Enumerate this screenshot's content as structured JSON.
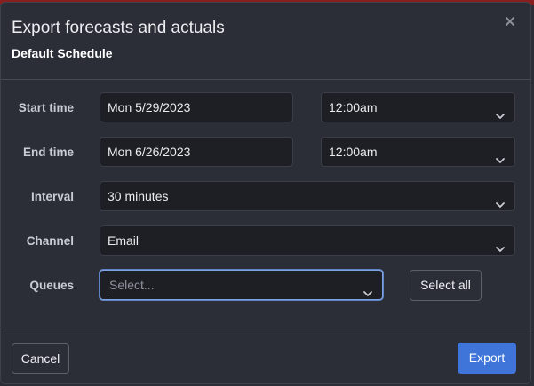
{
  "dialog": {
    "title": "Export forecasts and actuals",
    "subtitle": "Default Schedule"
  },
  "form": {
    "start_time": {
      "label": "Start time",
      "date": "Mon 5/29/2023",
      "time": "12:00am"
    },
    "end_time": {
      "label": "End time",
      "date": "Mon 6/26/2023",
      "time": "12:00am"
    },
    "interval": {
      "label": "Interval",
      "value": "30 minutes"
    },
    "channel": {
      "label": "Channel",
      "value": "Email"
    },
    "queues": {
      "label": "Queues",
      "placeholder": "Select...",
      "select_all_label": "Select all"
    }
  },
  "footer": {
    "cancel_label": "Cancel",
    "export_label": "Export"
  },
  "colors": {
    "background": "#2b2e37",
    "input_background": "#1d1f25",
    "primary": "#3f74d9",
    "focus_border": "#7fa3e0"
  },
  "icons": {
    "close": "close-icon",
    "dropdown": "chevron-down-icon"
  }
}
